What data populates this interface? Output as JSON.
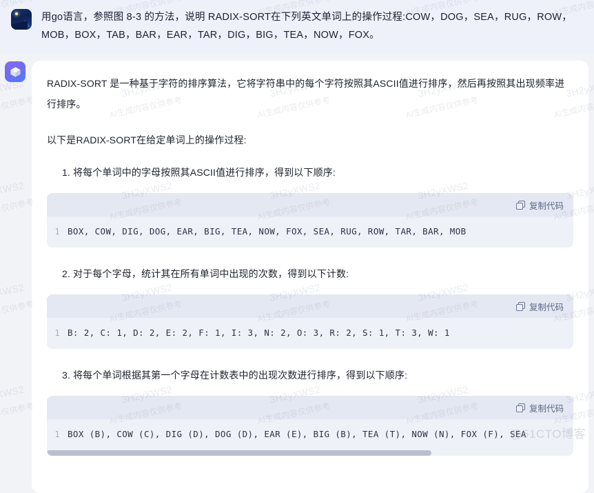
{
  "user_message": {
    "avatar_name": "user-avatar",
    "text": "用go语言，参照图 8-3 的方法，说明 RADIX-SORT在下列英文单词上的操作过程:COW，DOG，SEA，RUG，ROW，MOB，BOX，TAB，BAR，EAR，TAR，DIG，BIG，TEA，NOW，FOX。",
    "background": "#eef1fa"
  },
  "assistant_message": {
    "avatar_name": "assistant-avatar",
    "bubble_background": "#ffffff",
    "paragraphs": [
      "RADIX-SORT 是一种基于字符的排序算法，它将字符串中的每个字符按照其ASCII值进行排序，然后再按照其出现频率进行排序。",
      "以下是RADIX-SORT在给定单词上的操作过程:"
    ],
    "steps": [
      {
        "number": "1.",
        "text": "将每个单词中的字母按照其ASCII值进行排序，得到以下顺序:",
        "code": {
          "copy_label": "复制代码",
          "line_number": "1",
          "content": "BOX, COW, DIG, DOG, EAR, BIG, TEA, NOW, FOX, SEA, RUG, ROW, TAR, BAR, MOB",
          "has_scrollbar": false
        }
      },
      {
        "number": "2.",
        "text": "对于每个字母，统计其在所有单词中出现的次数，得到以下计数:",
        "code": {
          "copy_label": "复制代码",
          "line_number": "1",
          "content": "B: 2, C: 1, D: 2, E: 2, F: 1, I: 3, N: 2, O: 3, R: 2, S: 1, T: 3, W: 1",
          "has_scrollbar": false
        }
      },
      {
        "number": "3.",
        "text": "将每个单词根据其第一个字母在计数表中的出现次数进行排序，得到以下顺序:",
        "code": {
          "copy_label": "复制代码",
          "line_number": "1",
          "content": "BOX (B), COW (C), DIG (D), DOG (D), EAR (E), BIG (B), TEA (T), NOW (N), FOX (F), SEA",
          "has_scrollbar": true
        }
      }
    ]
  },
  "watermarks": {
    "code_text": "3H2yXWS2",
    "cn_text": "AI生成内容仅供参考",
    "site": "@51CTO博客"
  },
  "theme": {
    "page_background": "#f2f3f7",
    "code_header_background": "#e4e8f2",
    "code_body_background": "#eff1f8",
    "text_color": "#20242e",
    "copy_label_color": "#5d6a86"
  }
}
